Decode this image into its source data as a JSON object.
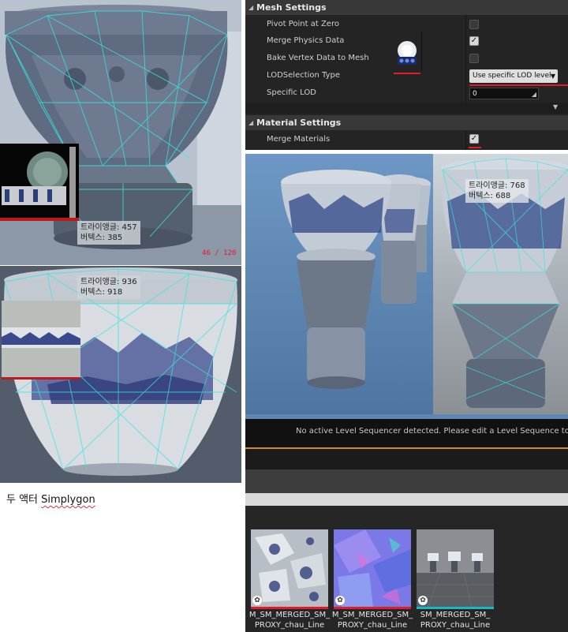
{
  "colors": {
    "panel_bg": "#242424",
    "section_header": "#383838",
    "red_marker": "#e01c2a",
    "material_bar": "#e01c2a",
    "mesh_bar": "#14b8c8",
    "orange_line": "#d48a1c"
  },
  "left_top_viewport": {
    "stats": {
      "triangles": "트라이앵글: 457",
      "vertices": "버텍스: 385"
    },
    "red_counter": "46 / 120"
  },
  "left_bottom_viewport": {
    "stats": {
      "triangles": "트라이앵글: 936",
      "vertices": "버텍스: 918"
    }
  },
  "caption": {
    "prefix": "두 액터 ",
    "name": "Simplygon"
  },
  "details": {
    "mesh_settings": {
      "title": "Mesh Settings",
      "props": [
        {
          "label": "Pivot Point at Zero",
          "checked": false
        },
        {
          "label": "Merge Physics Data",
          "checked": true
        },
        {
          "label": "Bake Vertex Data to Mesh",
          "checked": false
        }
      ],
      "lod_selection": {
        "label": "LODSelection Type",
        "value": "Use specific LOD level"
      },
      "specific_lod": {
        "label": "Specific LOD",
        "value": "0"
      }
    },
    "material_settings": {
      "title": "Material Settings",
      "merge_materials": {
        "label": "Merge Materials",
        "checked": true
      }
    },
    "icon": "simplygon-icon"
  },
  "right_viewport": {
    "stats": {
      "triangles": "트라이앵글: 768",
      "vertices": "버텍스: 688"
    },
    "message": "No active Level Sequencer detected. Please edit a Level Sequence to ena"
  },
  "content_browser": {
    "assets": [
      {
        "line1": "M_SM_MERGED_SM_",
        "line2": "PROXY_chau_Line",
        "kind": "material"
      },
      {
        "line1": "M_SM_MERGED_SM_",
        "line2": "PROXY_chau_Line",
        "kind": "normal"
      },
      {
        "line1": "SM_MERGED_SM_",
        "line2": "PROXY_chau_Line",
        "kind": "mesh"
      }
    ]
  }
}
